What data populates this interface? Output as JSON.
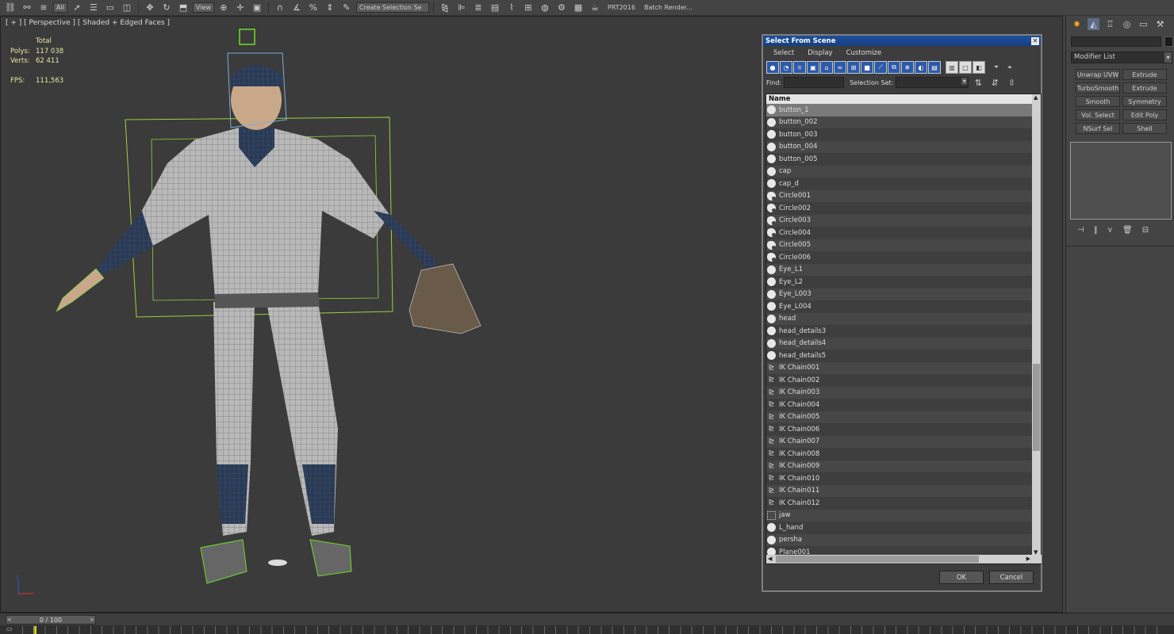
{
  "toolbar": {
    "filter_value": "All",
    "coord_value": "View",
    "selection_set_placeholder": "Create Selection Se",
    "profile_label": "PRT2016",
    "batch_render_label": "Batch Render..."
  },
  "viewport": {
    "label": "[ + ] [ Perspective ] [ Shaded + Edged Faces ]",
    "stats": {
      "total_label": "Total",
      "polys_label": "Polys:",
      "polys_value": "117 038",
      "verts_label": "Verts:",
      "verts_value": "62 411",
      "fps_label": "FPS:",
      "fps_value": "111,563"
    }
  },
  "dialog": {
    "title": "Select From Scene",
    "menu": [
      "Select",
      "Display",
      "Customize"
    ],
    "find_label": "Find:",
    "selection_set_label": "Selection Set:",
    "column_name": "Name",
    "ok_label": "OK",
    "cancel_label": "Cancel",
    "items": [
      {
        "name": "button_1",
        "icon": "geometry",
        "selected": true
      },
      {
        "name": "button_002",
        "icon": "geometry"
      },
      {
        "name": "button_003",
        "icon": "geometry"
      },
      {
        "name": "button_004",
        "icon": "geometry"
      },
      {
        "name": "button_005",
        "icon": "geometry"
      },
      {
        "name": "cap",
        "icon": "geometry"
      },
      {
        "name": "cap_d",
        "icon": "geometry"
      },
      {
        "name": "Circle001",
        "icon": "shape"
      },
      {
        "name": "Circle002",
        "icon": "shape"
      },
      {
        "name": "Circle003",
        "icon": "shape"
      },
      {
        "name": "Circle004",
        "icon": "shape"
      },
      {
        "name": "Circle005",
        "icon": "shape"
      },
      {
        "name": "Circle006",
        "icon": "shape"
      },
      {
        "name": "Eye_L1",
        "icon": "geometry"
      },
      {
        "name": "Eye_L2",
        "icon": "geometry"
      },
      {
        "name": "Eye_L003",
        "icon": "geometry"
      },
      {
        "name": "Eye_L004",
        "icon": "geometry"
      },
      {
        "name": "head",
        "icon": "geometry"
      },
      {
        "name": "head_details3",
        "icon": "geometry"
      },
      {
        "name": "head_details4",
        "icon": "geometry"
      },
      {
        "name": "head_details5",
        "icon": "geometry"
      },
      {
        "name": "IK Chain001",
        "icon": "ik"
      },
      {
        "name": "IK Chain002",
        "icon": "ik"
      },
      {
        "name": "IK Chain003",
        "icon": "ik"
      },
      {
        "name": "IK Chain004",
        "icon": "ik"
      },
      {
        "name": "IK Chain005",
        "icon": "ik"
      },
      {
        "name": "IK Chain006",
        "icon": "ik"
      },
      {
        "name": "IK Chain007",
        "icon": "ik"
      },
      {
        "name": "IK Chain008",
        "icon": "ik"
      },
      {
        "name": "IK Chain009",
        "icon": "ik"
      },
      {
        "name": "IK Chain010",
        "icon": "ik"
      },
      {
        "name": "IK Chain011",
        "icon": "ik"
      },
      {
        "name": "IK Chain012",
        "icon": "ik"
      },
      {
        "name": "jaw",
        "icon": "dummy"
      },
      {
        "name": "L_hand",
        "icon": "geometry"
      },
      {
        "name": "persha",
        "icon": "geometry"
      },
      {
        "name": "Plane001",
        "icon": "geometry"
      }
    ]
  },
  "command_panel": {
    "modifier_list_label": "Modifier List",
    "modifiers": [
      "Unwrap UVW",
      "Extrude",
      "TurboSmooth",
      "Extrude",
      "Smooth",
      "Symmetry",
      "Vol. Select",
      "Edit Poly",
      "NSurf Sel",
      "Shell"
    ]
  },
  "timeline": {
    "frame_label": "0 / 100"
  },
  "colors": {
    "viewport_bg": "#3b3b3b",
    "stats_text": "#e8e6a0",
    "dialog_title": "#1f4f9c",
    "selection_box": "#9bd23a",
    "bone": "#3b3bd8"
  }
}
